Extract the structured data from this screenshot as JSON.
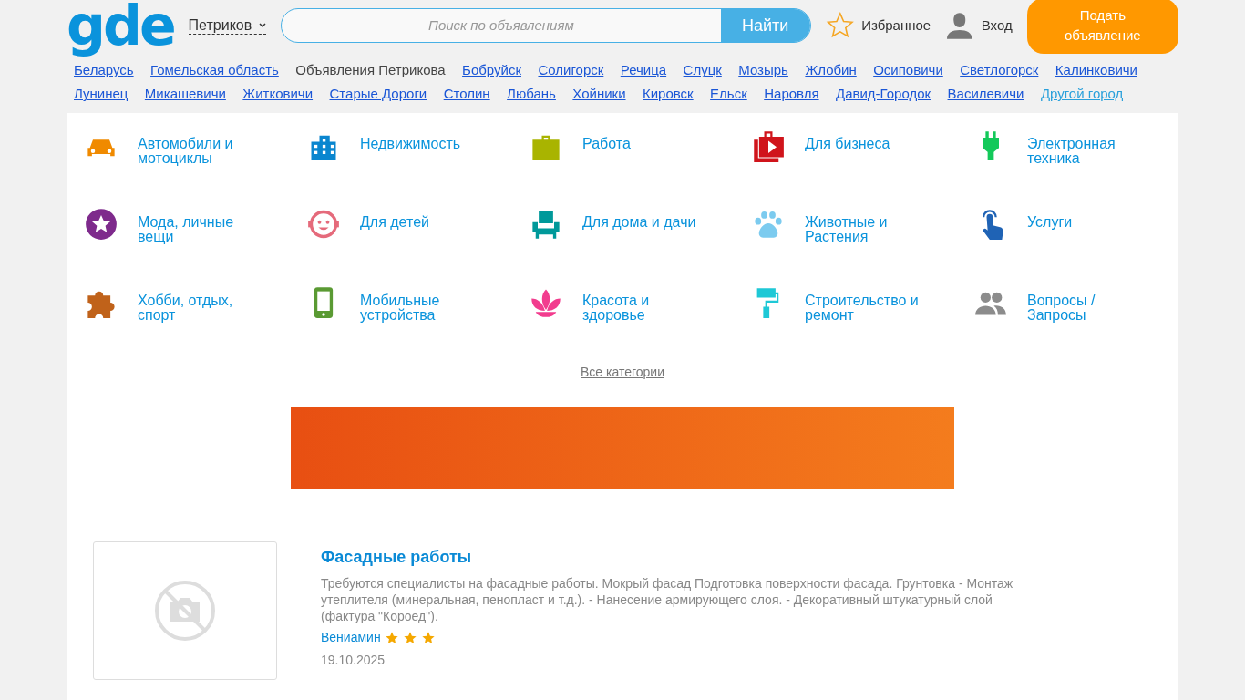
{
  "header": {
    "logo": "gde",
    "city": "Петриков",
    "search": {
      "placeholder": "Поиск по объявлениям",
      "button": "Найти"
    },
    "favorites": "Избранное",
    "login": "Вход",
    "post_button": "Подать объявление"
  },
  "locations": [
    {
      "text": "Беларусь",
      "kind": "link"
    },
    {
      "text": "Гомельская область",
      "kind": "link"
    },
    {
      "text": "Объявления Петрикова",
      "kind": "current"
    },
    {
      "text": "Бобруйск",
      "kind": "link"
    },
    {
      "text": "Солигорск",
      "kind": "link"
    },
    {
      "text": "Речица",
      "kind": "link"
    },
    {
      "text": "Слуцк",
      "kind": "link"
    },
    {
      "text": "Мозырь",
      "kind": "link"
    },
    {
      "text": "Жлобин",
      "kind": "link"
    },
    {
      "text": "Осиповичи",
      "kind": "link"
    },
    {
      "text": "Светлогорск",
      "kind": "link"
    },
    {
      "text": "Калинковичи",
      "kind": "link"
    },
    {
      "text": "Лунинец",
      "kind": "link"
    },
    {
      "text": "Микашевичи",
      "kind": "link"
    },
    {
      "text": "Житковичи",
      "kind": "link"
    },
    {
      "text": "Старые Дороги",
      "kind": "link"
    },
    {
      "text": "Столин",
      "kind": "link"
    },
    {
      "text": "Любань",
      "kind": "link"
    },
    {
      "text": "Хойники",
      "kind": "link"
    },
    {
      "text": "Кировск",
      "kind": "link"
    },
    {
      "text": "Ельск",
      "kind": "link"
    },
    {
      "text": "Наровля",
      "kind": "link"
    },
    {
      "text": "Давид-Городок",
      "kind": "link"
    },
    {
      "text": "Василевичи",
      "kind": "link"
    },
    {
      "text": "Другой город",
      "kind": "other"
    }
  ],
  "categories": [
    {
      "label": "Автомобили и мотоциклы",
      "color": "#f08a00"
    },
    {
      "label": "Недвижимость",
      "color": "#0a86cf"
    },
    {
      "label": "Работа",
      "color": "#a9b400"
    },
    {
      "label": "Для бизнеса",
      "color": "#d0141b"
    },
    {
      "label": "Электронная техника",
      "color": "#13c95a"
    },
    {
      "label": "Мода, личные вещи",
      "color": "#7e2a8c"
    },
    {
      "label": "Для детей",
      "color": "#e56a7b"
    },
    {
      "label": "Для дома и дачи",
      "color": "#00999a"
    },
    {
      "label": "Животные и Растения",
      "color": "#7ccbef"
    },
    {
      "label": "Услуги",
      "color": "#1f63b5"
    },
    {
      "label": "Хобби, отдых, спорт",
      "color": "#c0621a"
    },
    {
      "label": "Мобильные устройства",
      "color": "#5a9a33"
    },
    {
      "label": "Красота и здоровье",
      "color": "#f23c8e"
    },
    {
      "label": "Строительство и ремонт",
      "color": "#1ec8d6"
    },
    {
      "label": "Вопросы / Запросы",
      "color": "#8c8c8c"
    }
  ],
  "all_categories": "Все категории",
  "listings": [
    {
      "title": "Фасадные работы",
      "description": "Требуются специалисты на фасадные работы. Мокрый фасад Подготовка поверхности фасада.  Грунтовка - Монтаж утеплителя (минеральная, пенопласт и т.д.).  - Нанесение армирующего слоя.  - Декоративный штукатурный слой (фактура \"Короед\").",
      "author": "Вениамин",
      "stars": 3,
      "date": "19.10.2025"
    }
  ]
}
